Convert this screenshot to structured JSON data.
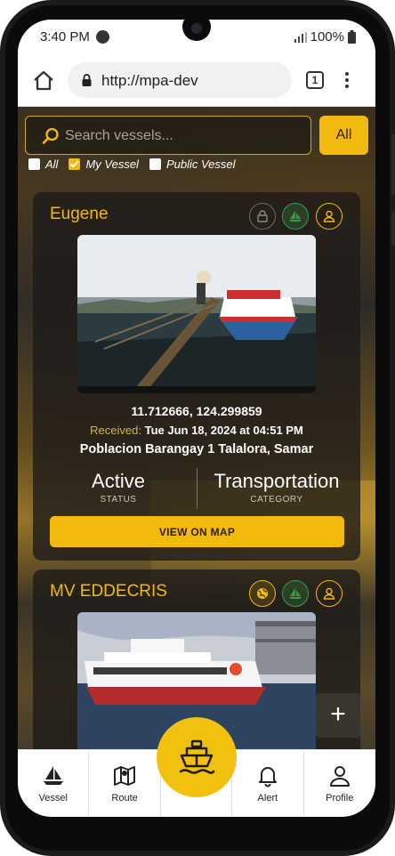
{
  "status_bar": {
    "time": "3:40 PM",
    "battery": "100%",
    "spotify_icon": "spotify-icon",
    "signal_icon": "signal-icon",
    "battery_icon": "battery-icon"
  },
  "browser": {
    "url": "http://mpa-dev",
    "tab_count": "1"
  },
  "search": {
    "placeholder": "Search vessels...",
    "all_button": "All"
  },
  "filters": [
    {
      "label": "All",
      "checked": false
    },
    {
      "label": "My Vessel",
      "checked": true
    },
    {
      "label": "Public Vessel",
      "checked": false
    }
  ],
  "vessels": [
    {
      "name": "Eugene",
      "badges": [
        "lock-icon",
        "sailboat-icon",
        "user-icon"
      ],
      "coordinates": "11.712666, 124.299859",
      "received_label": "Received:",
      "received_value": "Tue Jun 18, 2024 at 04:51 PM",
      "address": "Poblacion Barangay 1 Talalora, Samar",
      "status_value": "Active",
      "status_label": "STATUS",
      "category_value": "Transportation",
      "category_label": "CATEGORY",
      "map_button": "VIEW ON MAP"
    },
    {
      "name": "MV EDDECRIS",
      "badges": [
        "globe-icon",
        "sailboat-icon",
        "user-icon"
      ]
    }
  ],
  "fab": {
    "icon": "ship-icon"
  },
  "add_button": "+",
  "nav": [
    {
      "label": "Vessel",
      "icon": "sailboat-icon"
    },
    {
      "label": "Route",
      "icon": "map-icon"
    },
    {
      "label": "",
      "icon": ""
    },
    {
      "label": "Alert",
      "icon": "bell-icon"
    },
    {
      "label": "Profile",
      "icon": "user-icon"
    }
  ],
  "colors": {
    "accent": "#f2b90f",
    "badge_green": "#3a9b4a",
    "card_bg": "#1c1a18"
  }
}
